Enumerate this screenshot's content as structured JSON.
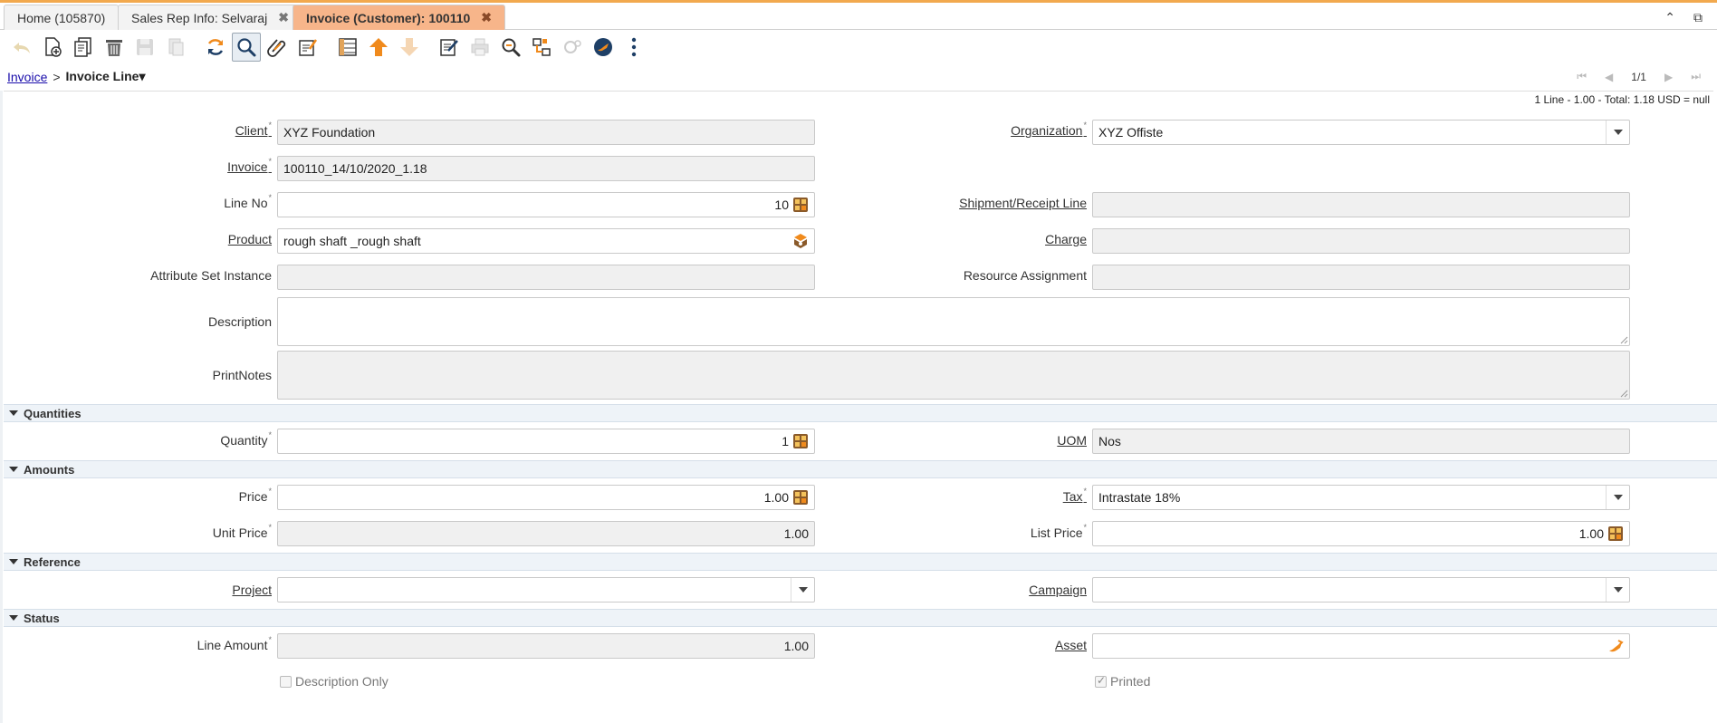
{
  "tabs": [
    {
      "label": "Home (105870)",
      "closable": false
    },
    {
      "label": "Sales Rep Info: Selvaraj",
      "closable": true
    },
    {
      "label": "Invoice (Customer): 100110",
      "closable": true,
      "active": true
    }
  ],
  "tab_close_glyph": "✖",
  "tabbar_right": {
    "collapse": "⌃",
    "restore": "⧉"
  },
  "toolbar_icons": [
    "undo-icon",
    "new-record-icon",
    "copy-record-icon",
    "delete-icon",
    "save-icon",
    "save-new-icon",
    "refresh-icon",
    "find-icon",
    "attachment-icon",
    "chat-icon",
    "grid-toggle-icon",
    "parent-record-icon",
    "detail-record-icon",
    "report-icon",
    "print-icon",
    "zoom-across-icon",
    "active-workflows-icon",
    "requests-icon",
    "product-info-icon",
    "more-icon"
  ],
  "breadcrumb": {
    "parent": "Invoice",
    "separator": ">",
    "current": "Invoice Line",
    "caret": "▾"
  },
  "navigation": {
    "first": "⏮",
    "prev": "◀",
    "count": "1/1",
    "next": "▶",
    "last": "⏭"
  },
  "status_line": "1 Line - 1.00 - Total: 1.18 USD = null",
  "mandatory_mark": "*",
  "fields": {
    "client": {
      "label": "Client",
      "value": "XYZ Foundation"
    },
    "organization": {
      "label": "Organization",
      "value": "XYZ Offiste"
    },
    "invoice": {
      "label": "Invoice",
      "value": "100110_14/10/2020_1.18"
    },
    "line_no": {
      "label": "Line No",
      "value": "10"
    },
    "shipment_receipt_line": {
      "label": "Shipment/Receipt Line",
      "value": ""
    },
    "product": {
      "label": "Product",
      "value": "rough shaft _rough shaft"
    },
    "charge": {
      "label": "Charge",
      "value": ""
    },
    "attribute_set_instance": {
      "label": "Attribute Set Instance",
      "value": ""
    },
    "resource_assignment": {
      "label": "Resource Assignment",
      "value": ""
    },
    "description": {
      "label": "Description",
      "value": ""
    },
    "print_notes": {
      "label": "PrintNotes",
      "value": ""
    },
    "quantity": {
      "label": "Quantity",
      "value": "1"
    },
    "uom": {
      "label": "UOM",
      "value": "Nos"
    },
    "price": {
      "label": "Price",
      "value": "1.00"
    },
    "tax": {
      "label": "Tax",
      "value": "Intrastate 18%"
    },
    "unit_price": {
      "label": "Unit Price",
      "value": "1.00"
    },
    "list_price": {
      "label": "List Price",
      "value": "1.00"
    },
    "project": {
      "label": "Project",
      "value": ""
    },
    "campaign": {
      "label": "Campaign",
      "value": ""
    },
    "line_amount": {
      "label": "Line Amount",
      "value": "1.00"
    },
    "asset": {
      "label": "Asset",
      "value": ""
    },
    "description_only": {
      "label": "Description Only",
      "checked": false
    },
    "printed": {
      "label": "Printed",
      "checked": true
    }
  },
  "groups": {
    "quantities": "Quantities",
    "amounts": "Amounts",
    "reference": "Reference",
    "status": "Status"
  },
  "colors": {
    "active_tab": "#f7b58a",
    "accent": "#f2a94e",
    "toolbar_orange": "#f08a1c",
    "group_bg": "#eef3f8"
  }
}
